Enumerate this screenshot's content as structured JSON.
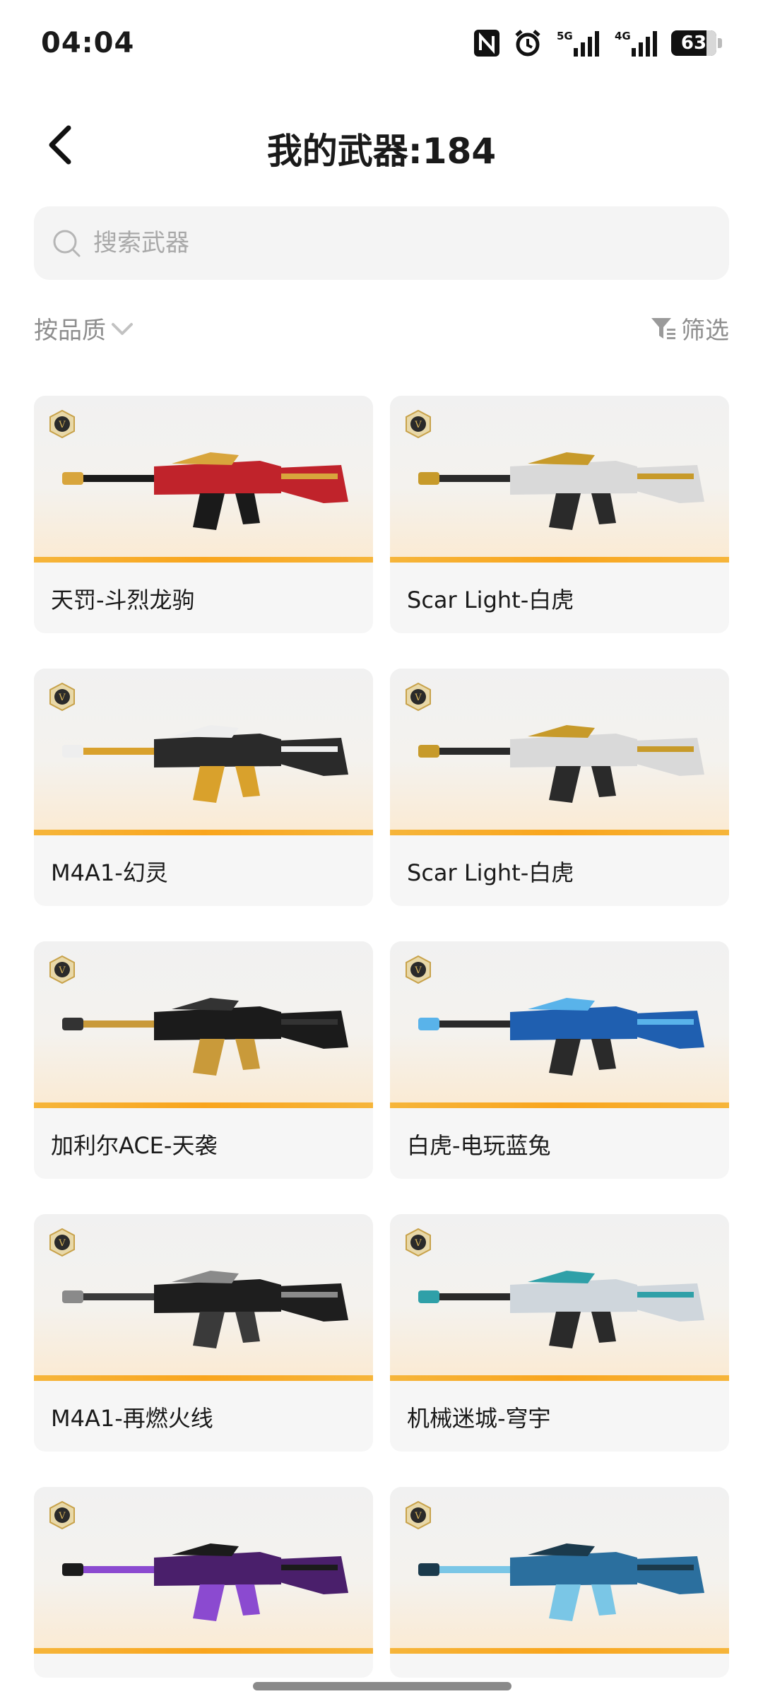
{
  "status_bar": {
    "time": "04:04",
    "signal_5g_label": "5G",
    "signal_4g_label": "4G",
    "battery": "63",
    "icons": [
      "nfc-icon",
      "alarm-icon",
      "signal-5g-icon",
      "signal-4g-icon",
      "battery-icon"
    ]
  },
  "header": {
    "title": "我的武器:184",
    "back_icon": "chevron-left-icon"
  },
  "search": {
    "placeholder": "搜索武器",
    "value": "",
    "icon": "search-icon"
  },
  "sort": {
    "label": "按品质",
    "icon": "chevron-down-icon"
  },
  "filter": {
    "label": "筛选",
    "icon": "funnel-icon"
  },
  "colors": {
    "accent_orange": "#f9a51d",
    "card_bg": "#f6f6f6",
    "badge_gold": "#c8a24a"
  },
  "weapons": [
    {
      "name": "天罚-斗烈龙驹",
      "badge": "V",
      "palette": [
        "#c0232b",
        "#1a1a1a",
        "#d8a53c"
      ]
    },
    {
      "name": "Scar Light-白虎",
      "badge": "V",
      "palette": [
        "#d9d9d9",
        "#2a2a2a",
        "#c79a2a"
      ]
    },
    {
      "name": "M4A1-幻灵",
      "badge": "V",
      "palette": [
        "#2a2a2a",
        "#d9a12c",
        "#eeeeee"
      ]
    },
    {
      "name": "Scar Light-白虎",
      "badge": "V",
      "palette": [
        "#d9d9d9",
        "#2a2a2a",
        "#c79a2a"
      ]
    },
    {
      "name": "加利尔ACE-天袭",
      "badge": "V",
      "palette": [
        "#1b1b1b",
        "#c99a3a",
        "#333333"
      ]
    },
    {
      "name": "白虎-电玩蓝兔",
      "badge": "V",
      "palette": [
        "#1f5fb0",
        "#2a2a2a",
        "#59b3ea"
      ]
    },
    {
      "name": "M4A1-再燃火线",
      "badge": "V",
      "palette": [
        "#1e1e1e",
        "#3a3a3a",
        "#8a8a8a"
      ]
    },
    {
      "name": "机械迷城-穹宇",
      "badge": "V",
      "palette": [
        "#cfd6dc",
        "#2a2a2a",
        "#2fa0a8"
      ]
    },
    {
      "name": "",
      "badge": "V",
      "palette": [
        "#4a1f6b",
        "#8b4ad0",
        "#1b1b1b"
      ]
    },
    {
      "name": "",
      "badge": "V",
      "palette": [
        "#2b6f9e",
        "#7ac6e6",
        "#1b3a4c"
      ]
    }
  ]
}
